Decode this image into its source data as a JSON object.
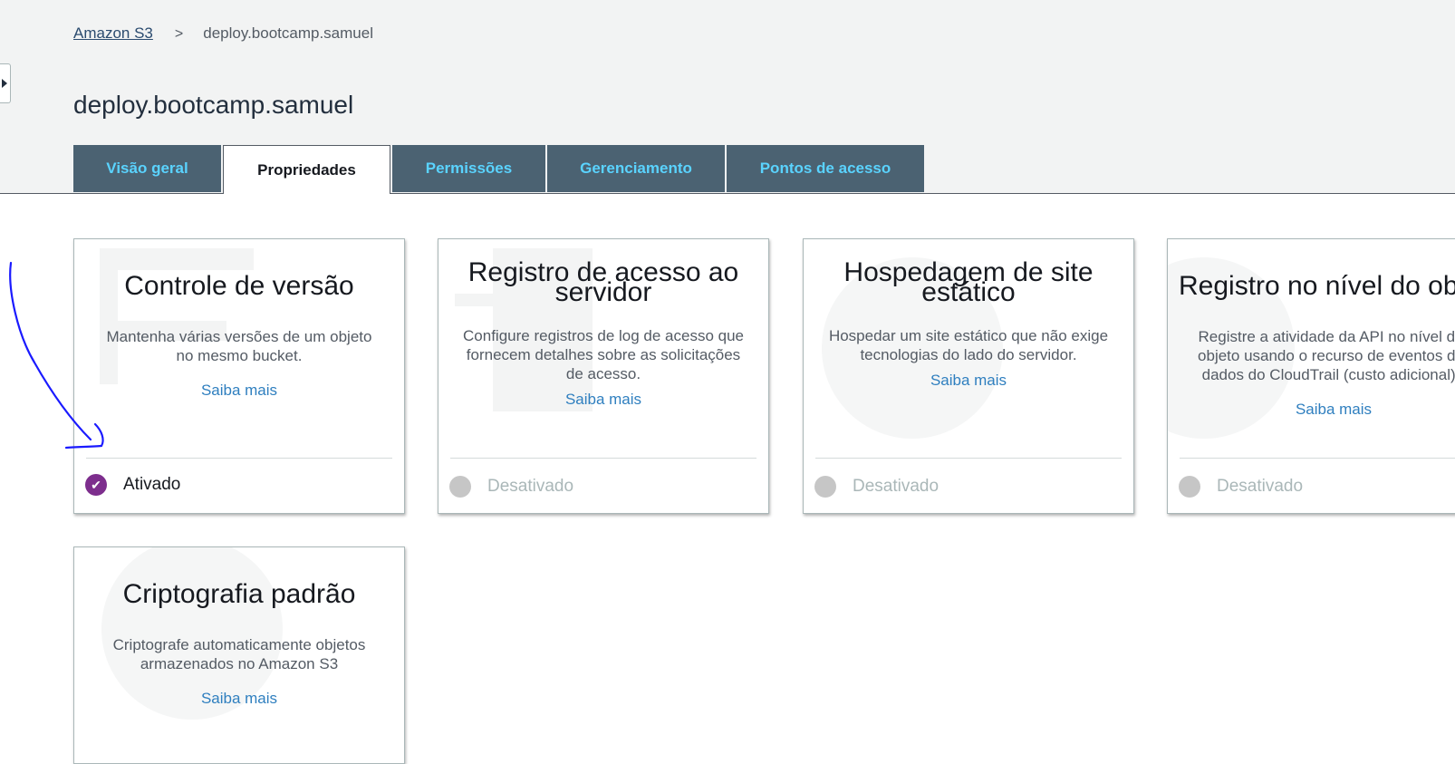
{
  "breadcrumb": {
    "root": "Amazon S3",
    "separator": ">",
    "current": "deploy.bootcamp.samuel"
  },
  "page_title": "deploy.bootcamp.samuel",
  "tabs": [
    {
      "label": "Visão geral",
      "active": false
    },
    {
      "label": "Propriedades",
      "active": true
    },
    {
      "label": "Permissões",
      "active": false
    },
    {
      "label": "Gerenciamento",
      "active": false
    },
    {
      "label": "Pontos de acesso",
      "active": false
    }
  ],
  "cards": [
    {
      "title": "Controle de versão",
      "description": "Mantenha várias versões de um objeto no mesmo bucket.",
      "link": "Saiba mais",
      "status": "Ativado",
      "enabled": true
    },
    {
      "title": "Registro de acesso ao servidor",
      "description": "Configure registros de log de acesso que fornecem detalhes sobre as solicitações de acesso.",
      "link": "Saiba mais",
      "status": "Desativado",
      "enabled": false
    },
    {
      "title": "Hospedagem de site estático",
      "description": "Hospedar um site estático que não exige tecnologias do lado do servidor.",
      "link": "Saiba mais",
      "status": "Desativado",
      "enabled": false
    },
    {
      "title": "Registro no nível do objeto",
      "description": "Registre a atividade da API no nível do objeto usando o recurso de eventos de dados do CloudTrail (custo adicional).",
      "link": "Saiba mais",
      "status": "Desativado",
      "enabled": false
    },
    {
      "title": "Criptografia padrão",
      "description": "Criptografe automaticamente objetos armazenados no Amazon S3",
      "link": "Saiba mais"
    }
  ],
  "colors": {
    "tab_bg": "#4b6272",
    "tab_text": "#5ad3ff",
    "link": "#2f7fbf",
    "enabled_dot": "#7d2e8d",
    "annotation": "#1a1aff"
  },
  "icons": {
    "expand": "caret-right-icon",
    "enabled": "check-circle-icon",
    "disabled": "circle-icon"
  }
}
